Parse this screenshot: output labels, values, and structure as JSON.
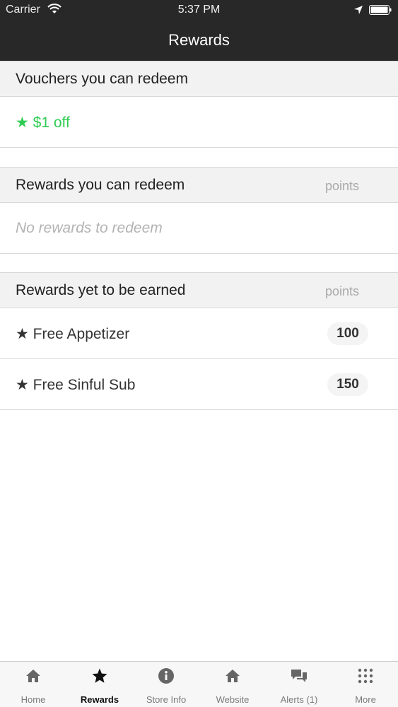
{
  "status_bar": {
    "carrier": "Carrier",
    "time": "5:37 PM"
  },
  "nav": {
    "title": "Rewards"
  },
  "vouchers": {
    "title": "Vouchers you can redeem",
    "items": [
      {
        "label": "★ $1 off"
      }
    ]
  },
  "redeemable": {
    "title": "Rewards you can redeem",
    "points_label": "points",
    "empty_text": "No rewards to redeem"
  },
  "to_earn": {
    "title": "Rewards yet to be earned",
    "points_label": "points",
    "items": [
      {
        "label": "★ Free Appetizer",
        "points": "100"
      },
      {
        "label": "★ Free Sinful Sub",
        "points": "150"
      }
    ]
  },
  "tabs": [
    {
      "label": "Home",
      "icon": "home-icon"
    },
    {
      "label": "Rewards",
      "icon": "star-icon"
    },
    {
      "label": "Store Info",
      "icon": "info-icon"
    },
    {
      "label": "Website",
      "icon": "home-icon"
    },
    {
      "label": "Alerts (1)",
      "icon": "chat-bubbles-icon"
    },
    {
      "label": "More",
      "icon": "grid-icon"
    }
  ],
  "colors": {
    "nav_bg": "#282828",
    "accent_green": "#2ecc52",
    "header_bg": "#f2f2f2"
  }
}
